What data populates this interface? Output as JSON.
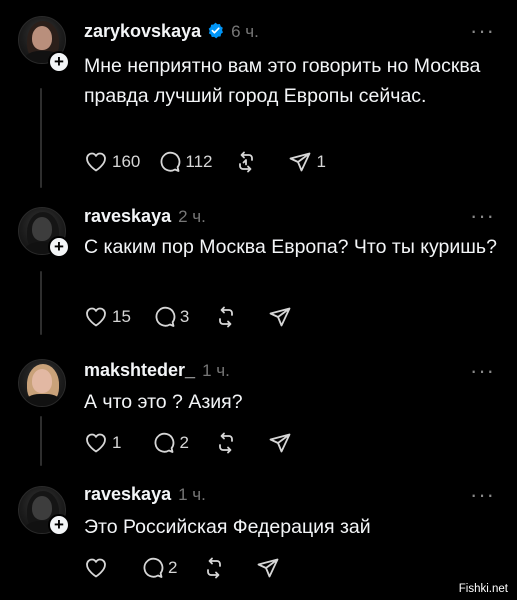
{
  "posts": [
    {
      "username": "zarykovskaya",
      "verified": true,
      "time": "6 ч.",
      "text": "Мне неприятно вам это говорить но Москва правда лучший город Европы сейчас.",
      "likes": "160",
      "comments": "112",
      "reposts": "",
      "shares": "1"
    },
    {
      "username": "raveskaya",
      "verified": false,
      "time": "2 ч.",
      "text": "С каким пор Москва Европа? Что ты куришь?",
      "likes": "15",
      "comments": "3",
      "reposts": "",
      "shares": ""
    },
    {
      "username": "makshteder_",
      "verified": false,
      "time": "1 ч.",
      "text": "А что это ? Азия?",
      "likes": "1",
      "comments": "2",
      "reposts": "",
      "shares": ""
    },
    {
      "username": "raveskaya",
      "verified": false,
      "time": "1 ч.",
      "text": "Это Российская Федерация зай",
      "likes": "",
      "comments": "2",
      "reposts": "",
      "shares": ""
    }
  ],
  "icons": {
    "more": "more-dots-icon",
    "like": "heart-icon",
    "comment": "comment-bubble-icon",
    "repost": "repost-icon",
    "share": "send-icon",
    "follow": "plus-icon",
    "verified": "verified-badge-icon"
  },
  "colors": {
    "background": "#000000",
    "text": "#f3f5f7",
    "muted": "#777777",
    "verified": "#0095f6"
  },
  "watermark": "Fishki.net"
}
